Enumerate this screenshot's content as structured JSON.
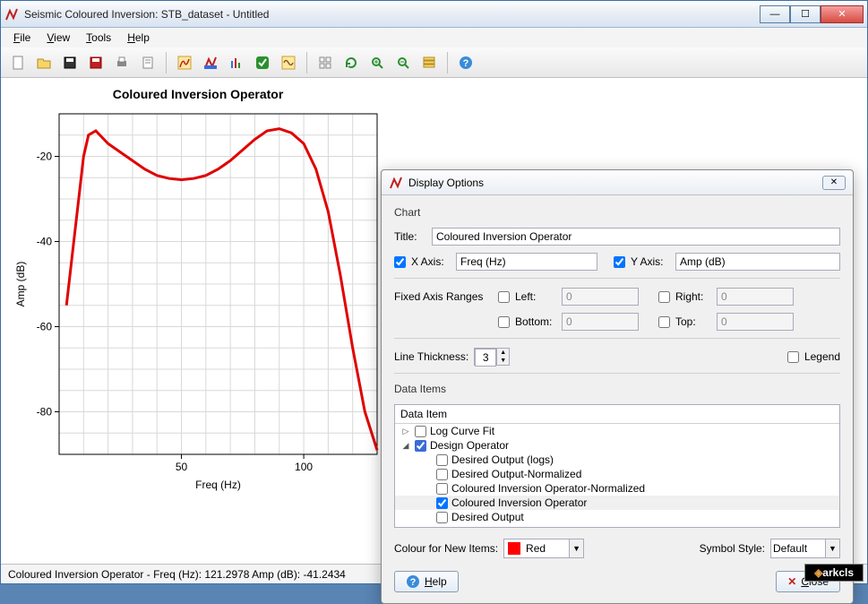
{
  "window": {
    "title": "Seismic Coloured Inversion: STB_dataset - Untitled"
  },
  "menubar": [
    "File",
    "View",
    "Tools",
    "Help"
  ],
  "toolbar": {
    "groups": [
      [
        "new",
        "open",
        "save",
        "save-red",
        "print",
        "properties"
      ],
      [
        "curve-red",
        "curve-blue",
        "bars",
        "check-green",
        "curve-brown"
      ],
      [
        "grid",
        "refresh",
        "zoom-in",
        "zoom-out",
        "stack"
      ],
      [
        "help"
      ]
    ]
  },
  "chart_data": {
    "type": "line",
    "title": "Coloured Inversion Operator",
    "xlabel": "Freq (Hz)",
    "ylabel": "Amp (dB)",
    "xlim": [
      0,
      130
    ],
    "ylim": [
      -90,
      -10
    ],
    "x_ticks": [
      50,
      100
    ],
    "y_ticks": [
      -20,
      -40,
      -60,
      -80
    ],
    "series": [
      {
        "name": "Coloured Inversion Operator",
        "color": "#e00000",
        "x": [
          3,
          5,
          8,
          10,
          12,
          15,
          20,
          25,
          30,
          35,
          40,
          45,
          50,
          55,
          60,
          65,
          70,
          75,
          80,
          85,
          90,
          95,
          100,
          105,
          110,
          115,
          120,
          125,
          130
        ],
        "y": [
          -55,
          -45,
          -30,
          -20,
          -15,
          -14,
          -17,
          -19,
          -21,
          -23,
          -24.5,
          -25.2,
          -25.5,
          -25.2,
          -24.5,
          -23,
          -21,
          -18.5,
          -16,
          -14,
          -13.5,
          -14.5,
          -17,
          -23,
          -33,
          -48,
          -65,
          -80,
          -89
        ]
      }
    ]
  },
  "statusbar": {
    "text": "Coloured Inversion Operator  -  Freq (Hz): 121.2978  Amp (dB): -41.2434"
  },
  "logo": "arkcls",
  "dialog": {
    "title": "Display Options",
    "chart_section": "Chart",
    "title_label": "Title:",
    "title_value": "Coloured Inversion Operator",
    "xaxis_label": "X Axis:",
    "xaxis_value": "Freq (Hz)",
    "xaxis_checked": true,
    "yaxis_label": "Y Axis:",
    "yaxis_value": "Amp (dB)",
    "yaxis_checked": true,
    "fixed_label": "Fixed Axis Ranges",
    "left_label": "Left:",
    "left_value": "0",
    "left_checked": false,
    "right_label": "Right:",
    "right_value": "0",
    "right_checked": false,
    "bottom_label": "Bottom:",
    "bottom_value": "0",
    "bottom_checked": false,
    "top_label": "Top:",
    "top_value": "0",
    "top_checked": false,
    "thickness_label": "Line Thickness:",
    "thickness_value": "3",
    "legend_label": "Legend",
    "legend_checked": false,
    "data_items_label": "Data Items",
    "tree_header": "Data Item",
    "tree": [
      {
        "indent": 0,
        "arrow": "▷",
        "checked": false,
        "label": "Log Curve Fit"
      },
      {
        "indent": 0,
        "arrow": "◢",
        "checked": true,
        "fill": "#3a6bd8",
        "label": "Design Operator"
      },
      {
        "indent": 1,
        "arrow": "",
        "checked": false,
        "label": "Desired Output (logs)"
      },
      {
        "indent": 1,
        "arrow": "",
        "checked": false,
        "label": "Desired Output-Normalized"
      },
      {
        "indent": 1,
        "arrow": "",
        "checked": false,
        "label": "Coloured Inversion Operator-Normalized"
      },
      {
        "indent": 1,
        "arrow": "",
        "checked": true,
        "label": "Coloured Inversion Operator",
        "selected": true
      },
      {
        "indent": 1,
        "arrow": "",
        "checked": false,
        "label": "Desired Output"
      }
    ],
    "colour_label": "Colour for New Items:",
    "colour_value": "Red",
    "symbol_label": "Symbol Style:",
    "symbol_value": "Default",
    "help_btn": "Help",
    "close_btn": "Close"
  }
}
